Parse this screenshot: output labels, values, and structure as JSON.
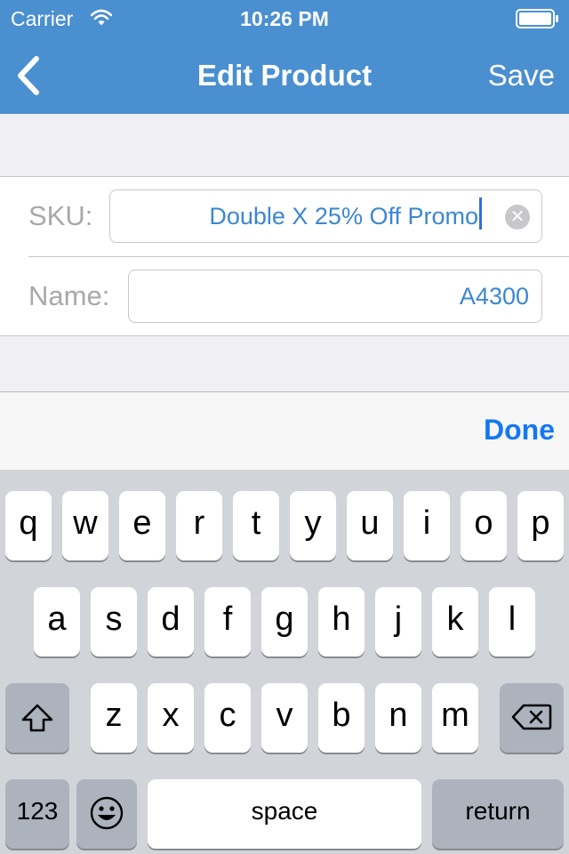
{
  "status_bar": {
    "carrier": "Carrier",
    "time": "10:26 PM"
  },
  "nav": {
    "title": "Edit Product",
    "save_label": "Save"
  },
  "form": {
    "sku": {
      "label": "SKU:",
      "value": "Double X 25% Off Promo"
    },
    "name": {
      "label": "Name:",
      "value": "A4300"
    }
  },
  "accessory": {
    "done_label": "Done"
  },
  "keyboard": {
    "row1": [
      "q",
      "w",
      "e",
      "r",
      "t",
      "y",
      "u",
      "i",
      "o",
      "p"
    ],
    "row2": [
      "a",
      "s",
      "d",
      "f",
      "g",
      "h",
      "j",
      "k",
      "l"
    ],
    "row3": [
      "z",
      "x",
      "c",
      "v",
      "b",
      "n",
      "m"
    ],
    "numbers_label": "123",
    "space_label": "space",
    "return_label": "return"
  },
  "colors": {
    "nav_background": "#4a8fd0",
    "field_text": "#3c87d0",
    "done_blue": "#1479f0",
    "keyboard_background": "#d1d4d9"
  }
}
